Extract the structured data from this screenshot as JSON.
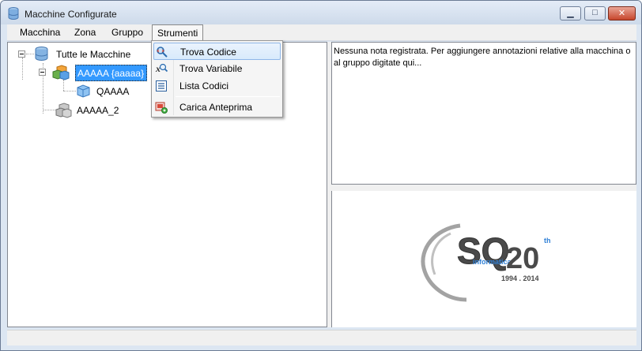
{
  "window": {
    "title": "Macchine Configurate",
    "controls": {
      "minimize": "▁",
      "maximize": "□",
      "close": "✕"
    }
  },
  "menubar": {
    "items": [
      {
        "label": "Macchina"
      },
      {
        "label": "Zona"
      },
      {
        "label": "Gruppo"
      },
      {
        "label": "Strumenti",
        "open": true
      }
    ]
  },
  "dropdown": {
    "items": [
      {
        "label": "Trova Codice",
        "icon": "find-code-icon",
        "highlighted": true
      },
      {
        "label": "Trova Variabile",
        "icon": "find-variable-icon"
      },
      {
        "label": "Lista Codici",
        "icon": "code-list-icon"
      },
      {
        "label": "Carica Anteprima",
        "icon": "load-preview-icon"
      }
    ]
  },
  "tree": {
    "root": {
      "label": "Tutte le Macchine",
      "icon": "database-icon"
    },
    "nodes": [
      {
        "label": "AAAAA {aaaaa}",
        "icon": "machine-group-icon",
        "selected": true
      },
      {
        "label": "QAAAA",
        "icon": "machine-icon"
      },
      {
        "label": "AAAAA_2",
        "icon": "machine-gray-icon"
      }
    ]
  },
  "notes": {
    "text": "Nessuna nota registrata. Per aggiungere annotazioni relative alla macchina o al gruppo digitate qui..."
  },
  "logo": {
    "letters": "SQ",
    "subtitle": "informatica",
    "anniversary": "20",
    "suffix": "th",
    "years": "1994 . 2014"
  },
  "colors": {
    "accent": "#3399ff",
    "logo_blue": "#2e7fd6",
    "logo_gray": "#4a4a4a"
  }
}
